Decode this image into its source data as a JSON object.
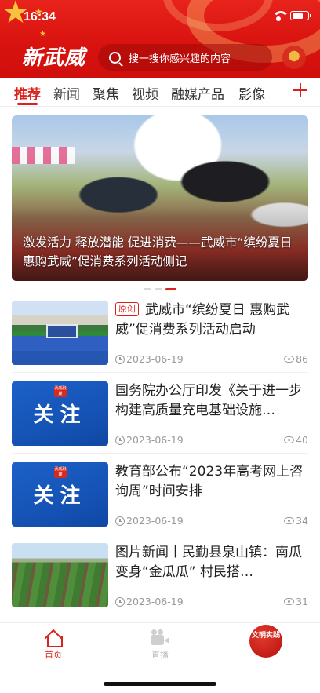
{
  "status_bar": {
    "time": "16:34"
  },
  "header": {
    "logo": "新武威",
    "search_placeholder": "搜一搜你感兴趣的内容"
  },
  "tabs": [
    {
      "label": "推荐",
      "active": true
    },
    {
      "label": "新闻"
    },
    {
      "label": "聚焦"
    },
    {
      "label": "视频"
    },
    {
      "label": "融媒产品"
    },
    {
      "label": "影像"
    }
  ],
  "banner": {
    "caption": "激发活力 释放潜能 促进消费——武威市“缤纷夏日 惠购武威”促消费系列活动侧记",
    "dot_count": 3,
    "active_dot": 2
  },
  "news": [
    {
      "tag": "原创",
      "title": "武威市“缤纷夏日 惠购武威”促消费系列活动启动",
      "date": "2023-06-19",
      "views": "86",
      "thumb": "stage"
    },
    {
      "tag": "",
      "title": "国务院办公厅印发《关于进一步构建高质量充电基础设施…",
      "date": "2023-06-19",
      "views": "40",
      "thumb": "notice",
      "thumb_text": "关注",
      "thumb_badge": "武威融媒"
    },
    {
      "tag": "",
      "title": "教育部公布“2023年高考网上咨询周”时间安排",
      "date": "2023-06-19",
      "views": "34",
      "thumb": "notice",
      "thumb_text": "关注",
      "thumb_badge": "武威融媒"
    },
    {
      "tag": "",
      "title": "图片新闻丨民勤县泉山镇：南瓜变身“金瓜瓜” 村民搭…",
      "date": "2023-06-19",
      "views": "31",
      "thumb": "field"
    }
  ],
  "bottom_nav": {
    "home": "首页",
    "live": "直播",
    "civic": "文明实践"
  },
  "colors": {
    "brand_red": "#d8221b",
    "accent_gold": "#f7c33c"
  }
}
